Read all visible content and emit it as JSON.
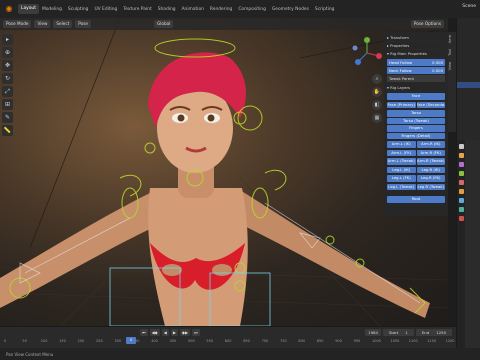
{
  "topbar": {
    "workspaces": [
      "Layout",
      "Modeling",
      "Sculpting",
      "UV Editing",
      "Texture Paint",
      "Shading",
      "Animation",
      "Rendering",
      "Compositing",
      "Geometry Nodes",
      "Scripting"
    ],
    "active_index": 0,
    "scene": "Scene"
  },
  "viewport_header": {
    "mode": "Pose Mode",
    "view": "View",
    "select": "Select",
    "pose": "Pose",
    "orientation": "Global",
    "pose_options": "Pose Options"
  },
  "npanel": {
    "sections": {
      "transform": "Transform",
      "properties": "Properties",
      "rig_main_props": "Rig Main Properties",
      "rig_layers": "Rig Layers"
    },
    "props": [
      {
        "label": "Head Follow",
        "value": "0.500"
      },
      {
        "label": "Neck Follow",
        "value": "0.000"
      },
      {
        "label": "Tweak Parent",
        "value": ""
      }
    ],
    "layers": [
      [
        "Face"
      ],
      [
        "Face (Primary)",
        "Face (Seconda..."
      ],
      [
        "Torso"
      ],
      [
        "Torso (Tweak)"
      ],
      [
        "Fingers"
      ],
      [
        "Fingers (Detail)"
      ],
      [
        "Arm.L (IK)",
        "Arm.R (IK)"
      ],
      [
        "Arm.L (FK)",
        "Arm.R (FK)"
      ],
      [
        "Arm.L (Tweak)",
        "Arm.R (Tweak)"
      ],
      [
        "Leg.L (IK)",
        "Leg.R (IK)"
      ],
      [
        "Leg.L (FK)",
        "Leg.R (FK)"
      ],
      [
        "Leg.L (Tweak)",
        "Leg.R (Tweak)"
      ],
      [
        "Root"
      ]
    ],
    "tabs": [
      "Item",
      "Tool",
      "View"
    ]
  },
  "timeline": {
    "current_frame": "0",
    "ruler": [
      "0",
      "50",
      "100",
      "150",
      "200",
      "250",
      "300",
      "350",
      "400",
      "450",
      "500",
      "550",
      "600",
      "650",
      "700",
      "750",
      "800",
      "850",
      "900",
      "950",
      "1000",
      "1050",
      "1100",
      "1150",
      "1200"
    ],
    "start_label": "Start",
    "start_value": "1",
    "end_label": "End",
    "end_value": "1250",
    "frame_box": "1984"
  },
  "status": {
    "text": "Pan View     Context Menu"
  },
  "colors": {
    "accent": "#4e7bc8",
    "hair": "#d4244a",
    "bikini": "#d81e2a",
    "rig_controls": "#b7d62b"
  }
}
